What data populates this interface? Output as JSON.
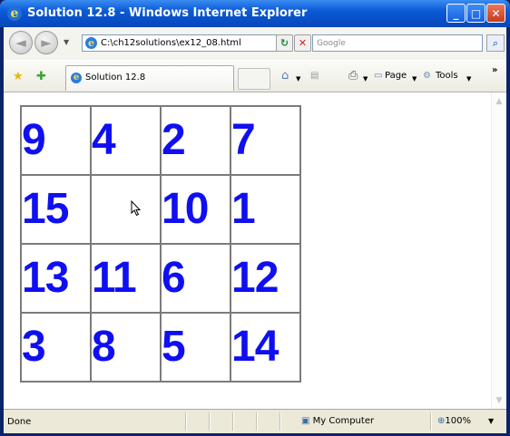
{
  "window": {
    "title": "Solution 12.8 - Windows Internet Explorer",
    "minimize": "_",
    "maximize": "□",
    "close": "✕"
  },
  "toolbar": {
    "back": "◄",
    "forward": "►",
    "history_dropdown": "▼",
    "address": "C:\\ch12solutions\\ex12_08.html",
    "address_dropdown": "▼",
    "refresh": "↻",
    "stop": "✕",
    "search_placeholder": "Google",
    "search_button": "⌕"
  },
  "tabs": {
    "favorites_star": "★",
    "add_favorites": "✚",
    "active_tab": "Solution 12.8",
    "home": "⌂",
    "feeds": "▤",
    "print": "⎙",
    "page_menu": "Page",
    "tools_menu": "Tools",
    "chevron": "»"
  },
  "puzzle": {
    "rows": [
      [
        "9",
        "4",
        "2",
        "7"
      ],
      [
        "15",
        "",
        "10",
        "1"
      ],
      [
        "13",
        "11",
        "6",
        "12"
      ],
      [
        "3",
        "8",
        "5",
        "14"
      ]
    ]
  },
  "status": {
    "text": "Done",
    "zone": "My Computer",
    "zoom": "100%"
  },
  "colors": {
    "tile_text": "#0f0ff2",
    "tile_border": "#7b7b7b",
    "title_bar": "#0a5ad6"
  }
}
